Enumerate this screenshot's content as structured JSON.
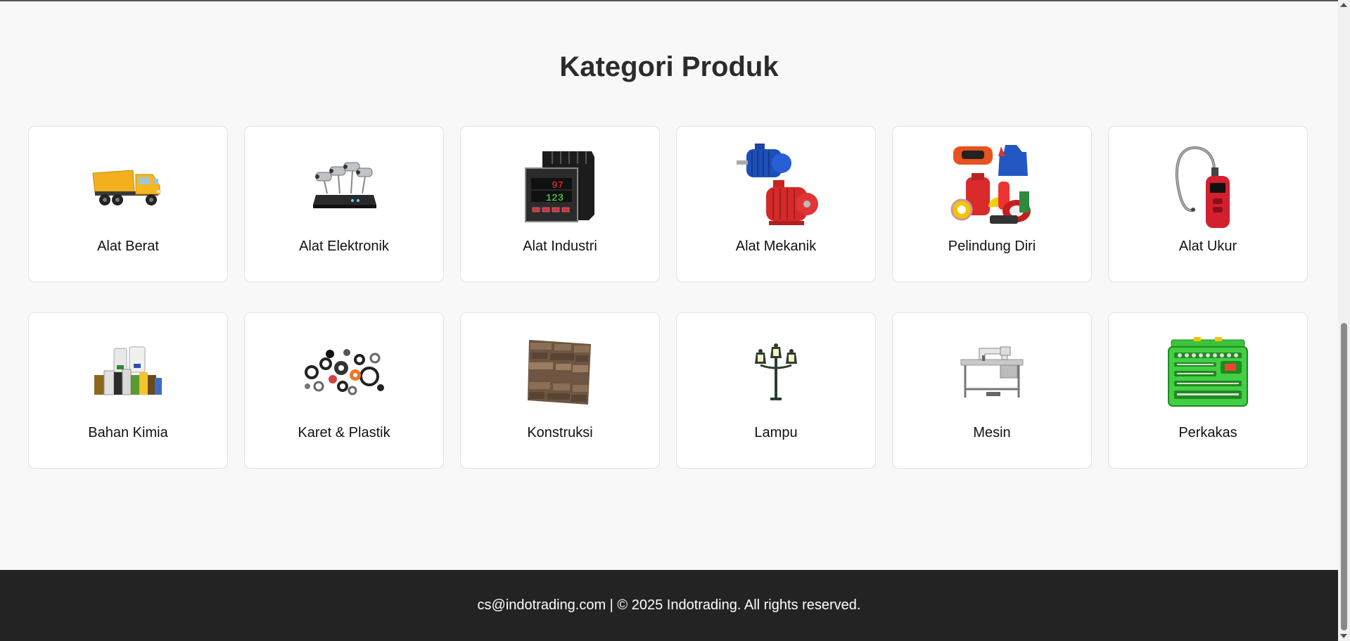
{
  "page": {
    "title": "Kategori Produk"
  },
  "categories": [
    {
      "label": "Alat Berat",
      "icon": "dump-truck-icon"
    },
    {
      "label": "Alat Elektronik",
      "icon": "cctv-camera-icon"
    },
    {
      "label": "Alat Industri",
      "icon": "temperature-controller-icon"
    },
    {
      "label": "Alat Mekanik",
      "icon": "electric-motor-icon"
    },
    {
      "label": "Pelindung Diri",
      "icon": "safety-equipment-icon"
    },
    {
      "label": "Alat Ukur",
      "icon": "gas-detector-icon"
    },
    {
      "label": "Bahan Kimia",
      "icon": "chemical-bottles-icon"
    },
    {
      "label": "Karet & Plastik",
      "icon": "rubber-parts-icon"
    },
    {
      "label": "Konstruksi",
      "icon": "stone-wall-panel-icon"
    },
    {
      "label": "Lampu",
      "icon": "street-lamp-icon"
    },
    {
      "label": "Mesin",
      "icon": "sewing-machine-icon"
    },
    {
      "label": "Perkakas",
      "icon": "toolbox-icon"
    }
  ],
  "footer": {
    "text": "cs@indotrading.com | © 2025 Indotrading. All rights reserved."
  },
  "colors": {
    "background": "#f8f8f8",
    "card": "#ffffff",
    "footer": "#232323"
  }
}
